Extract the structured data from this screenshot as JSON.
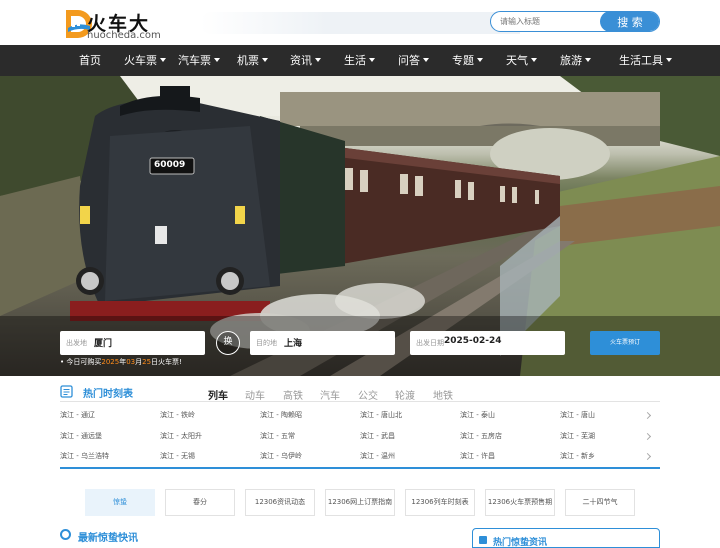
{
  "brand": {
    "name": "火车大",
    "domain": "huocheda.com"
  },
  "search": {
    "placeholder": "请输入标题",
    "button": "搜 索"
  },
  "nav": {
    "items": [
      {
        "label": "首页",
        "dropdown": false
      },
      {
        "label": "火车票",
        "dropdown": true
      },
      {
        "label": "汽车票",
        "dropdown": true
      },
      {
        "label": "机票",
        "dropdown": true
      },
      {
        "label": "资讯",
        "dropdown": true
      },
      {
        "label": "生活",
        "dropdown": true
      },
      {
        "label": "问答",
        "dropdown": true
      },
      {
        "label": "专题",
        "dropdown": true
      },
      {
        "label": "天气",
        "dropdown": true
      },
      {
        "label": "旅游",
        "dropdown": true
      },
      {
        "label": "生活工具",
        "dropdown": true
      }
    ]
  },
  "banner": {
    "locomotive_number": "60009",
    "from_label": "出发地",
    "from_value": "厦门",
    "swap_label": "换",
    "to_label": "目的地",
    "to_value": "上海",
    "date_label": "出发日期",
    "date_value": "2025-02-24",
    "book_button": "火车票预订",
    "tip_prefix": "今日可购买",
    "tip_year": "2025",
    "tip_sep1": "年",
    "tip_month": "03",
    "tip_sep2": "月",
    "tip_day": "25",
    "tip_suffix": "日火车票!"
  },
  "timetable": {
    "title": "热门时刻表",
    "tabs": [
      "列车",
      "动车",
      "高铁",
      "汽车",
      "公交",
      "轮渡",
      "地铁"
    ],
    "active_tab": 0,
    "routes": [
      [
        "滨江 - 通辽",
        "滨江 - 铁岭",
        "滨江 - 陶赖昭",
        "滨江 - 唐山北",
        "滨江 - 泰山",
        "滨江 - 唐山"
      ],
      [
        "滨江 - 通远堡",
        "滨江 - 太阳升",
        "滨江 - 五常",
        "滨江 - 武昌",
        "滨江 - 五房店",
        "滨江 - 芜湖"
      ],
      [
        "滨江 - 乌兰浩特",
        "滨江 - 无锡",
        "滨江 - 乌伊岭",
        "滨江 - 温州",
        "滨江 - 许昌",
        "滨江 - 新乡"
      ]
    ]
  },
  "quick_links": [
    "惊蛰",
    "春分",
    "12306资讯动态",
    "12306网上订票指南",
    "12306列车时刻表",
    "12306火车票预售期",
    "二十四节气"
  ],
  "news": {
    "title": "最新惊蛰快讯"
  },
  "hot": {
    "title": "热门惊蛰资讯"
  },
  "colors": {
    "accent": "#2e8fd8",
    "nav_bg": "#2b2b2b",
    "highlight": "#ff8c1a"
  }
}
